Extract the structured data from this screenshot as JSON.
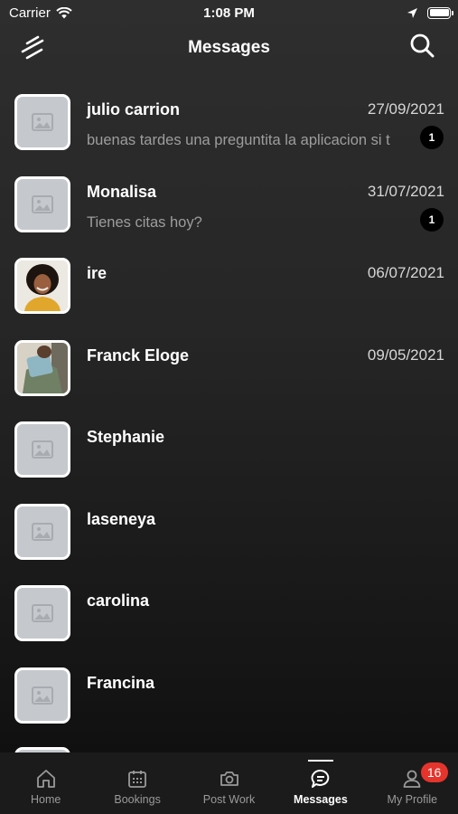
{
  "status_bar": {
    "carrier": "Carrier",
    "time": "1:08 PM"
  },
  "header": {
    "title": "Messages",
    "menu_icon": "menu-icon",
    "search_icon": "search-icon"
  },
  "conversations": [
    {
      "name": "julio carrion",
      "date": "27/09/2021",
      "preview": "buenas tardes  una preguntita  la aplicacion si t",
      "unread": "1",
      "avatar": "placeholder"
    },
    {
      "name": "Monalisa",
      "date": "31/07/2021",
      "preview": "Tienes citas hoy?",
      "unread": "1",
      "avatar": "placeholder"
    },
    {
      "name": "ire",
      "date": "06/07/2021",
      "preview": "",
      "unread": "",
      "avatar": "photo-woman"
    },
    {
      "name": "Franck Eloge",
      "date": "09/05/2021",
      "preview": "",
      "unread": "",
      "avatar": "photo-person"
    },
    {
      "name": "Stephanie",
      "date": "",
      "preview": "",
      "unread": "",
      "avatar": "placeholder"
    },
    {
      "name": "laseneya",
      "date": "",
      "preview": "",
      "unread": "",
      "avatar": "placeholder"
    },
    {
      "name": "carolina",
      "date": "",
      "preview": "",
      "unread": "",
      "avatar": "placeholder"
    },
    {
      "name": "Francina",
      "date": "",
      "preview": "",
      "unread": "",
      "avatar": "placeholder"
    }
  ],
  "tabs": [
    {
      "label": "Home",
      "icon": "home-icon",
      "active": false
    },
    {
      "label": "Bookings",
      "icon": "calendar-icon",
      "active": false
    },
    {
      "label": "Post Work",
      "icon": "camera-icon",
      "active": false
    },
    {
      "label": "Messages",
      "icon": "chat-icon",
      "active": true
    },
    {
      "label": "My Profile",
      "icon": "profile-icon",
      "active": false,
      "badge": "16"
    }
  ],
  "colors": {
    "badge": "#e5342c",
    "avatar_placeholder": "#c5c8cc",
    "tab_bar": "#1b1b1b"
  }
}
